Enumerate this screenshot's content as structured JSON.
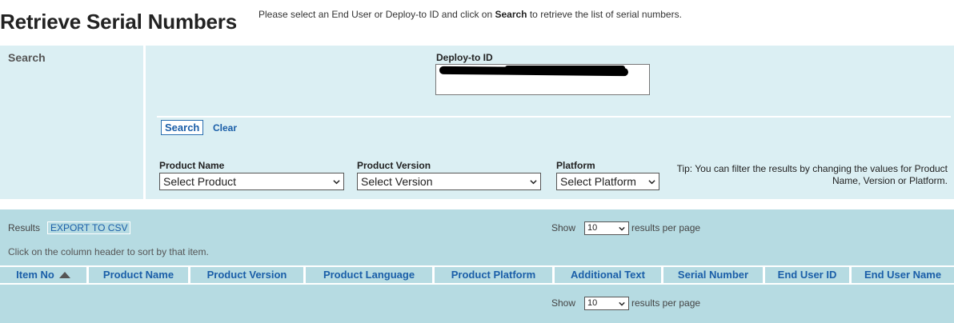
{
  "header": {
    "title": "Retrieve Serial Numbers",
    "instruction_prefix": "Please select an End User or Deploy-to ID and click on ",
    "instruction_bold": "Search",
    "instruction_suffix": " to retrieve the list of serial numbers."
  },
  "search": {
    "section_label": "Search",
    "deploy_label": "Deploy-to ID",
    "deploy_value": "",
    "search_button": "Search",
    "clear_link": "Clear"
  },
  "filters": {
    "product_name": {
      "label": "Product Name",
      "selected": "Select Product"
    },
    "product_version": {
      "label": "Product Version",
      "selected": "Select Version"
    },
    "platform": {
      "label": "Platform",
      "selected": "Select Platform"
    },
    "tip": "Tip: You can filter the results by changing the values for Product Name, Version or Platform."
  },
  "results": {
    "label": "Results",
    "export_button": "EXPORT TO CSV",
    "show_label": "Show",
    "per_page_value": "10",
    "per_page_suffix": "results per page",
    "sort_hint": "Click on the column header to sort by that item.",
    "columns": [
      "Item No",
      "Product Name",
      "Product Version",
      "Product Language",
      "Product Platform",
      "Additional Text",
      "Serial Number",
      "End User ID",
      "End User Name"
    ]
  },
  "icons": {
    "sort": "sort-ascending-icon",
    "dropdown": "chevron-down-icon"
  },
  "colors": {
    "link": "#1a5ea8",
    "search_bg": "#dbeff3",
    "results_bg": "#b6dbe2"
  }
}
